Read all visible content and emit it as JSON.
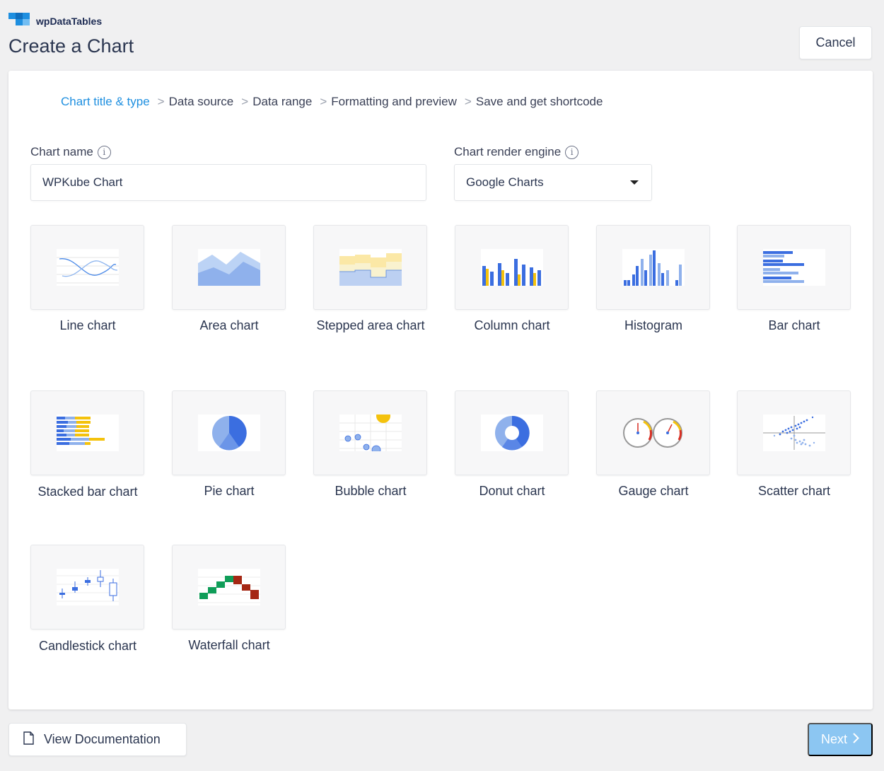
{
  "brand": {
    "name": "wpDataTables"
  },
  "page": {
    "title": "Create a Chart",
    "cancel_label": "Cancel"
  },
  "steps": [
    {
      "label": "Chart title & type",
      "active": true
    },
    {
      "label": "Data source",
      "active": false
    },
    {
      "label": "Data range",
      "active": false
    },
    {
      "label": "Formatting and preview",
      "active": false
    },
    {
      "label": "Save and get shortcode",
      "active": false
    }
  ],
  "step_separator": ">",
  "form": {
    "name_label": "Chart name",
    "name_value": "WPKube Chart",
    "engine_label": "Chart render engine",
    "engine_value": "Google Charts",
    "info_glyph": "i"
  },
  "chart_types": [
    {
      "label": "Line chart",
      "icon": "line-chart-icon"
    },
    {
      "label": "Area chart",
      "icon": "area-chart-icon"
    },
    {
      "label": "Stepped area chart",
      "icon": "stepped-area-chart-icon"
    },
    {
      "label": "Column chart",
      "icon": "column-chart-icon"
    },
    {
      "label": "Histogram",
      "icon": "histogram-icon"
    },
    {
      "label": "Bar chart",
      "icon": "bar-chart-icon"
    },
    {
      "label": "Stacked bar chart",
      "icon": "stacked-bar-chart-icon"
    },
    {
      "label": "Pie chart",
      "icon": "pie-chart-icon"
    },
    {
      "label": "Bubble chart",
      "icon": "bubble-chart-icon"
    },
    {
      "label": "Donut chart",
      "icon": "donut-chart-icon"
    },
    {
      "label": "Gauge chart",
      "icon": "gauge-chart-icon"
    },
    {
      "label": "Scatter chart",
      "icon": "scatter-chart-icon"
    },
    {
      "label": "Candlestick chart",
      "icon": "candlestick-chart-icon"
    },
    {
      "label": "Waterfall chart",
      "icon": "waterfall-chart-icon"
    }
  ],
  "footer": {
    "doc_label": "View Documentation",
    "next_label": "Next"
  },
  "colors": {
    "accent": "#1e8fe0",
    "next_disabled": "#8cc6f2",
    "blue": "#4285f4",
    "yellow": "#f4c20d",
    "green": "#0f9d58",
    "red": "#a52714"
  }
}
